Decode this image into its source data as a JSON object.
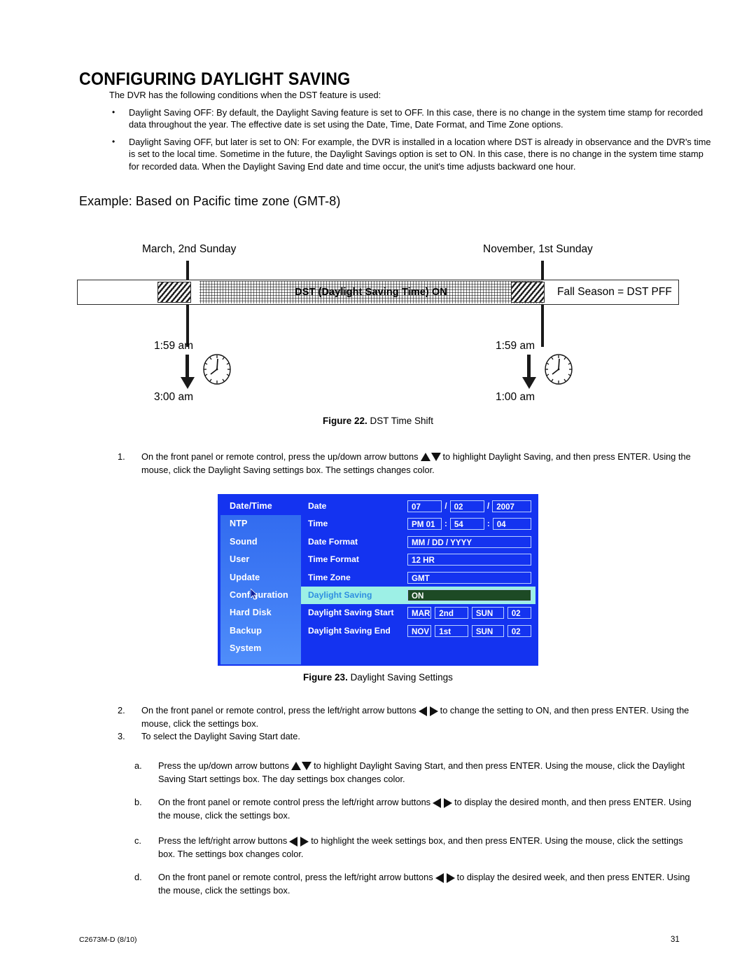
{
  "document": {
    "title": "CONFIGURING DAYLIGHT SAVING",
    "intro": "The DVR has the following conditions when the DST feature is used:",
    "bullets": [
      "Daylight Saving OFF: By default, the Daylight Saving feature is set to OFF. In this case, there is no change in the system time stamp for recorded data throughout the year. The effective date is set using the Date, Time, Date Format, and Time Zone options.",
      "Daylight Saving OFF, but later is set to ON: For example, the DVR is installed in a location where DST is already in observance and the DVR's time is set to the local time. Sometime in the future, the Daylight Savings option is set to ON. In this case, there is no change in the system time stamp for recorded data. When the Daylight Saving End date and time occur, the unit's time adjusts backward one hour."
    ],
    "example_heading": "Example:  Based on Pacific time zone (GMT-8)"
  },
  "figure22": {
    "start_label": "March, 2nd Sunday",
    "end_label": "November, 1st Sunday",
    "bar_on_text": "DST (Daylight Saving Time) ON",
    "bar_off_text": "Fall Season = DST PFF",
    "spring_before_time": "1:59 am",
    "spring_after_time": "3:00 am",
    "fall_before_time": "1:59 am",
    "fall_after_time": "1:00 am",
    "caption_number": "Figure 22.",
    "caption_text": "DST Time Shift"
  },
  "figure23": {
    "caption_number": "Figure 23.",
    "caption_text": "Daylight Saving Settings",
    "sidebar": [
      "Date/Time",
      "NTP",
      "Sound",
      "User",
      "Update",
      "Configuration",
      "Hard Disk",
      "Backup",
      "System"
    ],
    "rows": {
      "date_label": "Date",
      "date_month": "07",
      "date_day": "02",
      "date_year": "2007",
      "date_sep1": "/",
      "date_sep2": "/",
      "time_label": "Time",
      "time_hour": "PM  01",
      "time_min": "54",
      "time_sec": "04",
      "time_sep1": ":",
      "time_sep2": ":",
      "date_format_label": "Date Format",
      "date_format_value": "MM / DD / YYYY",
      "time_format_label": "Time Format",
      "time_format_value": "12 HR",
      "time_zone_label": "Time Zone",
      "time_zone_value": "GMT",
      "dst_label": "Daylight Saving",
      "dst_value": "ON",
      "dst_start_label": "Daylight Saving Start",
      "dst_start_month": "MAR",
      "dst_start_week": "2nd",
      "dst_start_day": "SUN",
      "dst_start_hour": "02",
      "dst_end_label": "Daylight Saving End",
      "dst_end_month": "NOV",
      "dst_end_week": "1st",
      "dst_end_day": "SUN",
      "dst_end_hour": "02"
    },
    "colors": {
      "background": "#1433f0",
      "sidebar_top": "#2f68ef",
      "sidebar_bottom": "#4f8dfa",
      "highlight_row": "#9df0e6",
      "value_box_active": "#1d4a25",
      "field_border": "#b9d0ff"
    }
  },
  "steps": {
    "step1": {
      "number": "1.",
      "part_a": "On the front panel or remote control, press the up/down arrow buttons",
      "part_b": "to highlight Daylight Saving, and then press ENTER. Using the mouse, click the Daylight Saving settings box. The settings changes color."
    },
    "step2": {
      "number": "2.",
      "part_a": "On the front panel or remote control, press the left/right arrow buttons",
      "part_b": "to change the setting to ON, and then press ENTER. Using the mouse, click the settings box."
    },
    "step3": {
      "number": "3.",
      "text": "To select the Daylight Saving Start date."
    },
    "sub_a": {
      "number": "a.",
      "part_a": "Press the up/down arrow buttons",
      "part_b": "to highlight Daylight Saving Start, and then press ENTER. Using the mouse, click the Daylight Saving Start settings box. The day settings box changes color."
    },
    "sub_b": {
      "number": "b.",
      "part_a": "On the front panel or remote control press the left/right arrow buttons",
      "part_b": "to display the desired month, and then press ENTER. Using the mouse, click the settings box."
    },
    "sub_c": {
      "number": "c.",
      "part_a": "Press the left/right arrow buttons",
      "part_b": "to highlight the week settings box, and then press ENTER. Using the mouse, click the settings box. The settings box changes color."
    },
    "sub_d": {
      "number": "d.",
      "part_a": "On the front panel or remote control, press the left/right arrow buttons",
      "part_b": "to display the desired week, and then press ENTER. Using the mouse, click the settings box."
    }
  },
  "footer": {
    "document_code": "C2673M-D (8/10)",
    "page_number": "31"
  }
}
